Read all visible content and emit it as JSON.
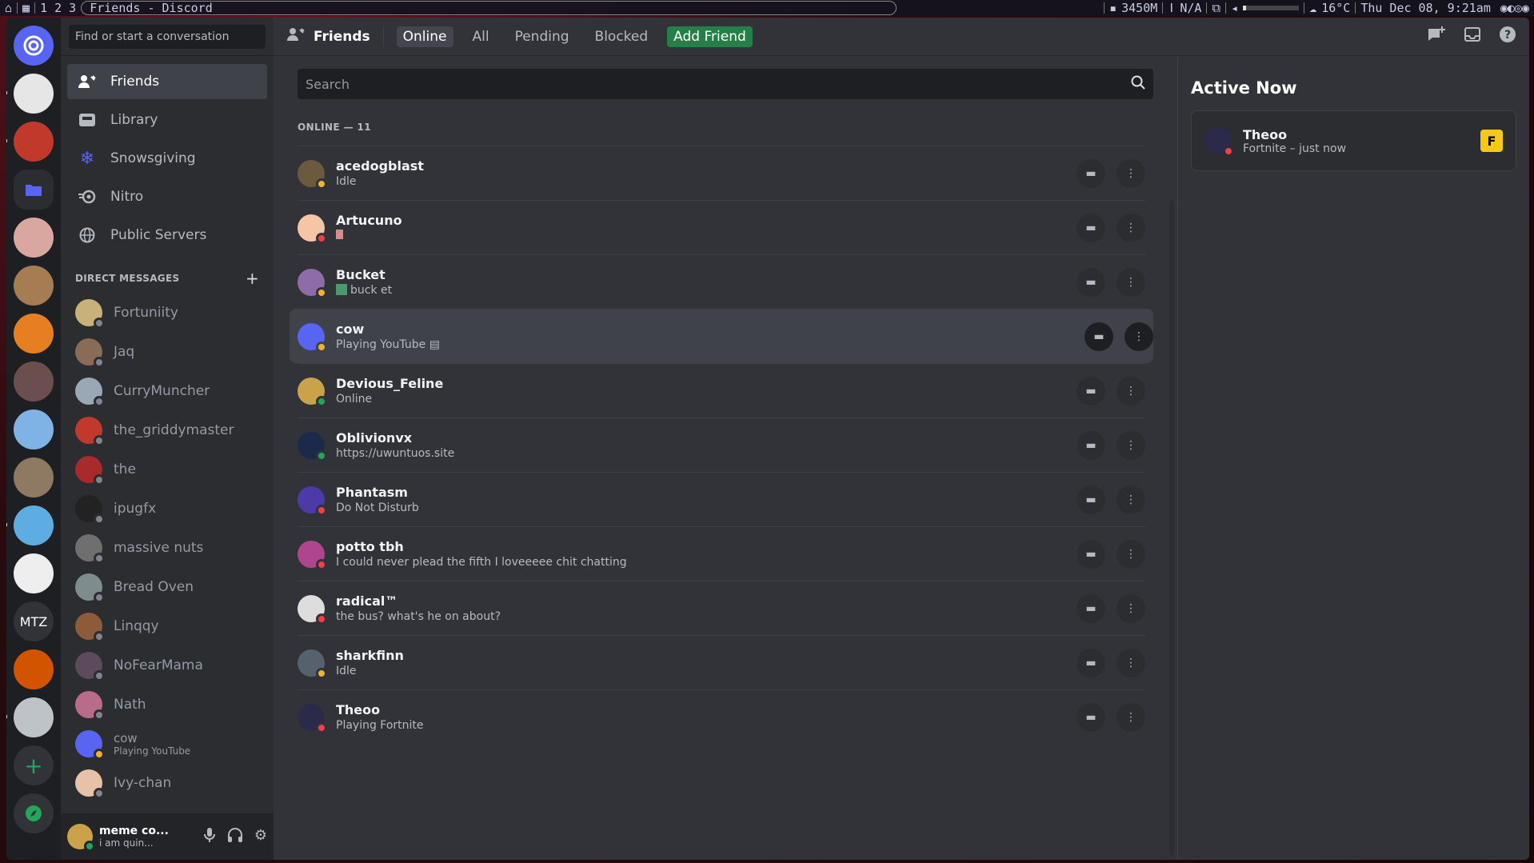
{
  "topbar": {
    "workspaces": "1 2 3",
    "window_title": "Friends - Discord",
    "memory": "3450M",
    "battery": "N/A",
    "weather": "16°C",
    "clock": "Thu Dec 08, 9:21am"
  },
  "guilds": {
    "text_guild": "MTZ"
  },
  "sidebar": {
    "search_placeholder": "Find or start a conversation",
    "nav": [
      {
        "label": "Friends"
      },
      {
        "label": "Library"
      },
      {
        "label": "Snowsgiving"
      },
      {
        "label": "Nitro"
      },
      {
        "label": "Public Servers"
      }
    ],
    "dm_header": "DIRECT MESSAGES",
    "dms": [
      {
        "name": "Fortuniity",
        "sub": ""
      },
      {
        "name": "Jaq",
        "sub": ""
      },
      {
        "name": "CurryMuncher",
        "sub": ""
      },
      {
        "name": "the_griddymaster",
        "sub": ""
      },
      {
        "name": "the",
        "sub": ""
      },
      {
        "name": "ipugfx",
        "sub": ""
      },
      {
        "name": "massive nuts",
        "sub": ""
      },
      {
        "name": "Bread Oven",
        "sub": ""
      },
      {
        "name": "Linqqy",
        "sub": ""
      },
      {
        "name": "NoFearMama",
        "sub": ""
      },
      {
        "name": "Nath",
        "sub": ""
      },
      {
        "name": "cow",
        "sub": "Playing YouTube"
      },
      {
        "name": "Ivy-chan",
        "sub": ""
      }
    ],
    "user": {
      "name": "meme co...",
      "status": "i am quin..."
    }
  },
  "header": {
    "title": "Friends",
    "tabs": {
      "online": "Online",
      "all": "All",
      "pending": "Pending",
      "blocked": "Blocked",
      "add_friend": "Add Friend"
    }
  },
  "friends": {
    "search_placeholder": "Search",
    "section_title": "ONLINE — 11",
    "list": [
      {
        "name": "acedogblast",
        "status": "Idle"
      },
      {
        "name": "Artucuno",
        "status": ""
      },
      {
        "name": "Bucket",
        "status": "buck et"
      },
      {
        "name": "cow",
        "status": "Playing YouTube"
      },
      {
        "name": "Devious_Feline",
        "status": "Online"
      },
      {
        "name": "Oblivionvx",
        "status": "https://uwuntuos.site"
      },
      {
        "name": "Phantasm",
        "status": "Do Not Disturb"
      },
      {
        "name": "potto tbh",
        "status": "I could never plead the fifth I loveeeee chit chatting"
      },
      {
        "name": "radical™",
        "status": "the bus? what's he on about?"
      },
      {
        "name": "sharkfinn",
        "status": "Idle"
      },
      {
        "name": "Theoo",
        "status": "Playing Fortnite"
      }
    ]
  },
  "active_now": {
    "title": "Active Now",
    "card": {
      "name": "Theoo",
      "activity": "Fortnite – just now",
      "game_letter": "F"
    }
  },
  "colors": {
    "accent": "#5865f2",
    "online": "#23a55a",
    "idle": "#f0b232",
    "dnd": "#f23f43",
    "add_friend": "#248046"
  }
}
